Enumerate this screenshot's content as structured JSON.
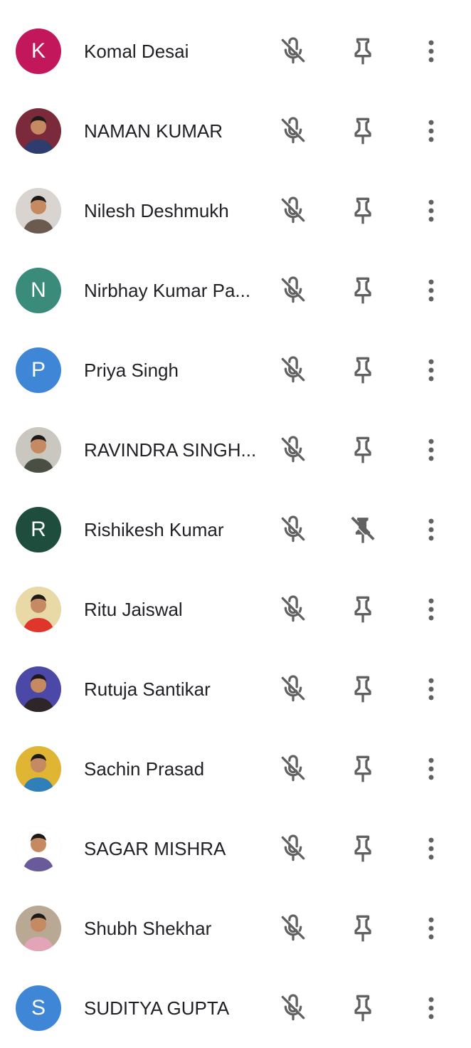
{
  "colors": {
    "icon": "#616161",
    "text": "#202124"
  },
  "participants": [
    {
      "name": "Komal Desai",
      "avatar_type": "letter",
      "initial": "K",
      "avatar_color": "#c2185b",
      "pinned": false
    },
    {
      "name": "NAMAN KUMAR",
      "avatar_type": "photo",
      "photo_bg": "#7a2a3a",
      "photo_fg": "#2e3c6e",
      "pinned": false
    },
    {
      "name": "Nilesh Deshmukh",
      "avatar_type": "photo",
      "photo_bg": "#d9d4cf",
      "photo_fg": "#6b5b4e",
      "pinned": false
    },
    {
      "name": "Nirbhay Kumar Pa...",
      "avatar_type": "letter",
      "initial": "N",
      "avatar_color": "#3b8b7a",
      "pinned": false
    },
    {
      "name": "Priya Singh",
      "avatar_type": "letter",
      "initial": "P",
      "avatar_color": "#3f87d6",
      "pinned": false
    },
    {
      "name": "RAVINDRA SINGH...",
      "avatar_type": "photo",
      "photo_bg": "#c9c7c0",
      "photo_fg": "#4a4f44",
      "pinned": false
    },
    {
      "name": "Rishikesh Kumar",
      "avatar_type": "letter",
      "initial": "R",
      "avatar_color": "#1e4d3d",
      "pinned": true
    },
    {
      "name": "Ritu Jaiswal",
      "avatar_type": "photo",
      "photo_bg": "#e9d9a6",
      "photo_fg": "#e0352b",
      "pinned": false
    },
    {
      "name": "Rutuja Santikar",
      "avatar_type": "photo",
      "photo_bg": "#4b48a8",
      "photo_fg": "#2d2528",
      "pinned": false
    },
    {
      "name": "Sachin Prasad",
      "avatar_type": "photo",
      "photo_bg": "#e0b534",
      "photo_fg": "#2f7fb8",
      "pinned": false
    },
    {
      "name": "SAGAR MISHRA",
      "avatar_type": "photo",
      "photo_bg": "#ffffff",
      "photo_fg": "#6a5a9a",
      "pinned": false
    },
    {
      "name": "Shubh Shekhar",
      "avatar_type": "photo",
      "photo_bg": "#b8a894",
      "photo_fg": "#e4a4b8",
      "pinned": false
    },
    {
      "name": "SUDITYA GUPTA",
      "avatar_type": "letter",
      "initial": "S",
      "avatar_color": "#3f87d6",
      "pinned": false
    }
  ]
}
